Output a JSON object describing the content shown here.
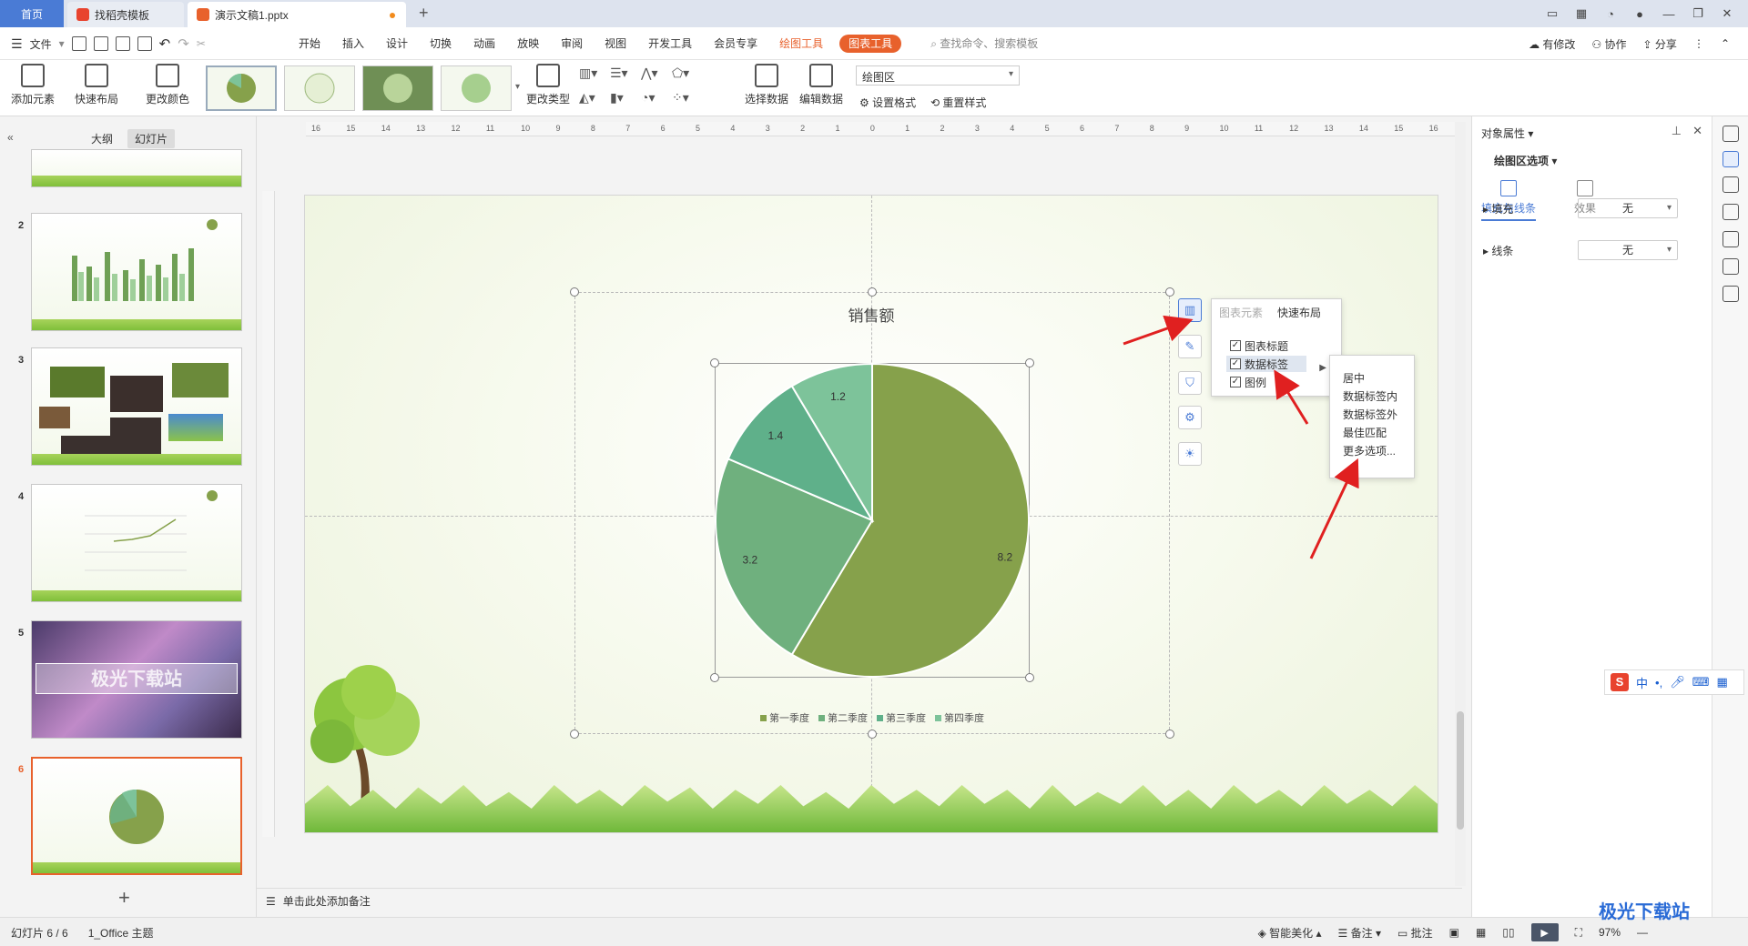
{
  "tabs": {
    "home": "首页",
    "template": "找稻壳模板",
    "doc": "演示文稿1.pptx",
    "new": "+"
  },
  "menu": {
    "file": "文件",
    "items": [
      "开始",
      "插入",
      "设计",
      "切换",
      "动画",
      "放映",
      "审阅",
      "视图",
      "开发工具",
      "会员专享"
    ],
    "drawing_tools": "绘图工具",
    "chart_tools": "图表工具",
    "search": "查找命令、搜索模板",
    "modified": "有修改",
    "collab": "协作",
    "share": "分享"
  },
  "ribbon": {
    "add_element": "添加元素",
    "quick_layout": "快速布局",
    "change_color": "更改颜色",
    "change_type": "更改类型",
    "select_data": "选择数据",
    "edit_data": "编辑数据",
    "area_select": "绘图区",
    "set_format": "设置格式",
    "reset_style": "重置样式"
  },
  "left_panel": {
    "outline_tab": "大纲",
    "slides_tab": "幻灯片",
    "slide_numbers": [
      "2",
      "3",
      "4",
      "5",
      "6"
    ],
    "slide5_text": "极光下载站"
  },
  "chart_data": {
    "type": "pie",
    "title": "销售额",
    "categories": [
      "第一季度",
      "第二季度",
      "第三季度",
      "第四季度"
    ],
    "values": [
      8.2,
      3.2,
      1.4,
      1.2
    ],
    "colors": [
      "#86a14b",
      "#6fb07e",
      "#5fb08a",
      "#7dc39a"
    ],
    "data_labels": [
      "8.2",
      "3.2",
      "1.4",
      "1.2"
    ]
  },
  "chart_popup": {
    "tab_elements": "图表元素",
    "tab_layout": "快速布局",
    "opt_title": "图表标题",
    "opt_labels": "数据标签",
    "opt_legend": "图例"
  },
  "submenu": {
    "items": [
      "居中",
      "数据标签内",
      "数据标签外",
      "最佳匹配",
      "更多选项..."
    ]
  },
  "notes": {
    "placeholder": "单击此处添加备注"
  },
  "right_panel": {
    "title": "对象属性",
    "sub": "绘图区选项",
    "tab_fill": "填充与线条",
    "tab_effect": "效果",
    "fill_label": "填充",
    "fill_value": "无",
    "line_label": "线条",
    "line_value": "无"
  },
  "status": {
    "slide": "幻灯片 6 / 6",
    "theme": "1_Office 主题",
    "beautify": "智能美化",
    "notes": "备注",
    "comments": "批注",
    "zoom": "97%"
  },
  "ime": {
    "lang": "中"
  },
  "watermark": "极光下载站"
}
